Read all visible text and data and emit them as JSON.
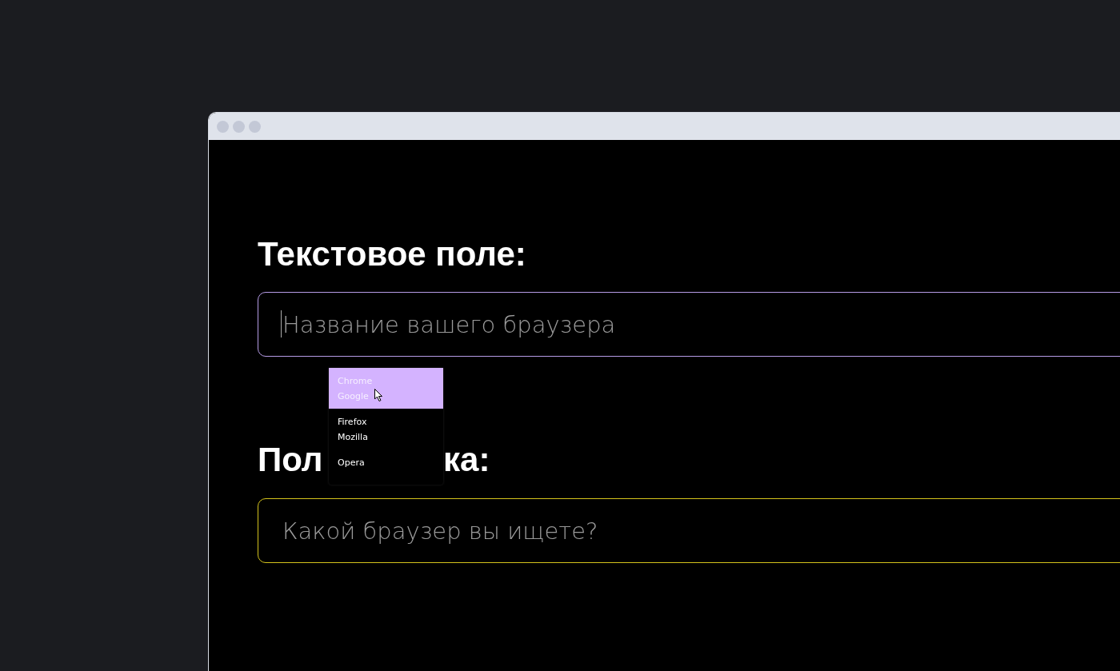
{
  "text_field": {
    "label": "Текстовое поле:",
    "placeholder": "Название вашего браузера",
    "focused": true
  },
  "suggestions": [
    {
      "value": "Chrome",
      "label": "Google",
      "selected": true
    },
    {
      "value": "Firefox",
      "label": "Mozilla",
      "selected": false
    },
    {
      "value": "Opera",
      "selected": false
    }
  ],
  "search_field": {
    "label_parts": [
      "Пол",
      "ка:"
    ],
    "placeholder": "Какой браузер вы ищете?"
  }
}
